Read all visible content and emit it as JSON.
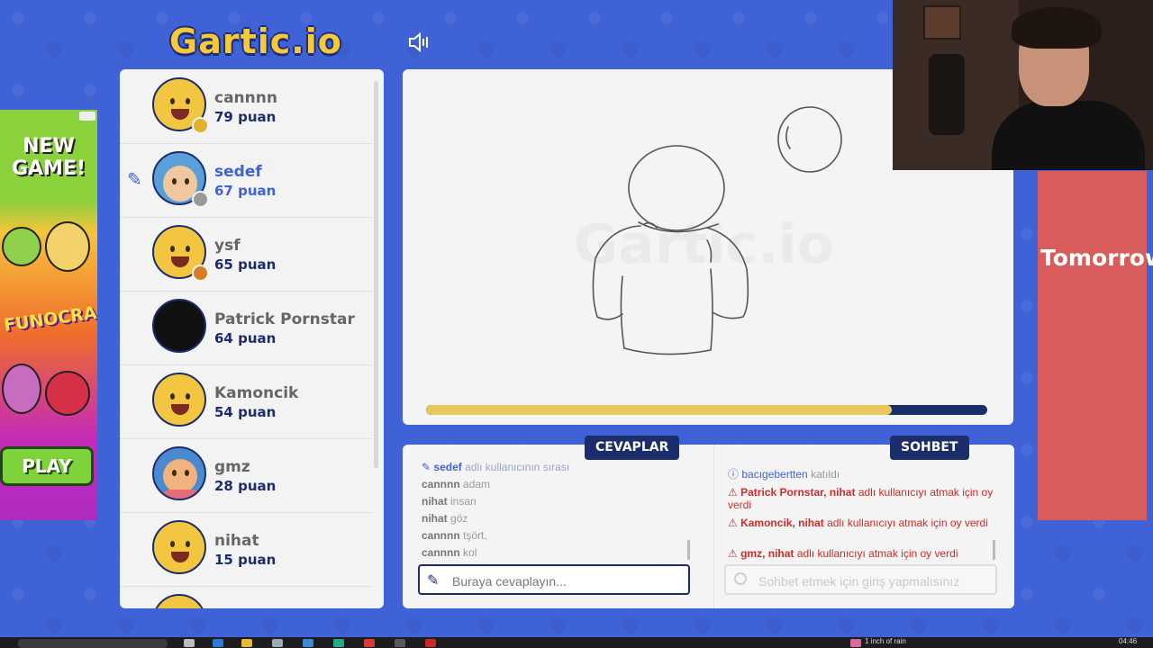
{
  "header": {
    "logo": "Gartic.io",
    "sound_icon": "speaker-icon"
  },
  "ad_left": {
    "new_game": "NEW GAME!",
    "brand": "FUNOCRACY",
    "play": "PLAY"
  },
  "players": [
    {
      "name": "cannnn",
      "score": "79 puan",
      "dot_color": "#e3b02a"
    },
    {
      "name": "sedef",
      "score": "67 puan",
      "dot_color": "#9a9a9a",
      "drawing": true
    },
    {
      "name": "ysf",
      "score": "65 puan",
      "dot_color": "#d97b20"
    },
    {
      "name": "Patrick Pornstar",
      "score": "64 puan"
    },
    {
      "name": "Kamoncik",
      "score": "54 puan"
    },
    {
      "name": "gmz",
      "score": "28 puan"
    },
    {
      "name": "nihat",
      "score": "15 puan"
    }
  ],
  "round": {
    "timer_remaining": 0.83
  },
  "tabs": {
    "answers": "CEVAPLAR",
    "chat": "SOHBET"
  },
  "answers": {
    "turn_user": "sedef",
    "turn_text": "adlı kullanıcının sırası",
    "guesses": [
      {
        "user": "cannnn",
        "text": "adam"
      },
      {
        "user": "nihat",
        "text": "insan"
      },
      {
        "user": "nihat",
        "text": "göz"
      },
      {
        "user": "cannnn",
        "text": "tşört,"
      },
      {
        "user": "cannnn",
        "text": "kol"
      }
    ],
    "input_placeholder": "Buraya cevaplayın..."
  },
  "chat": {
    "join": {
      "user": "bacıgebertten",
      "text": "katıldı"
    },
    "votes": [
      {
        "users": "Patrick Pornstar, nihat",
        "text": "adlı kullanıcıyı atmak için oy verdi"
      },
      {
        "users": "Kamoncik, nihat",
        "text": "adlı kullanıcıyı atmak için oy verdi"
      },
      {
        "users": "gmz, nihat",
        "text": "adlı kullanıcıyı atmak için oy verdi"
      }
    ],
    "input_placeholder": "Sohbet etmek için giriş yapmalısınız"
  },
  "ad_right": {
    "text": "Tomorrow,"
  },
  "taskbar": {
    "weather": "1 inch of rain",
    "time": "04:46"
  },
  "colors": {
    "background": "#3f62d6",
    "navy": "#1c2d6b",
    "timer_fill": "#e8c85a",
    "alert": "#d22a2a"
  }
}
